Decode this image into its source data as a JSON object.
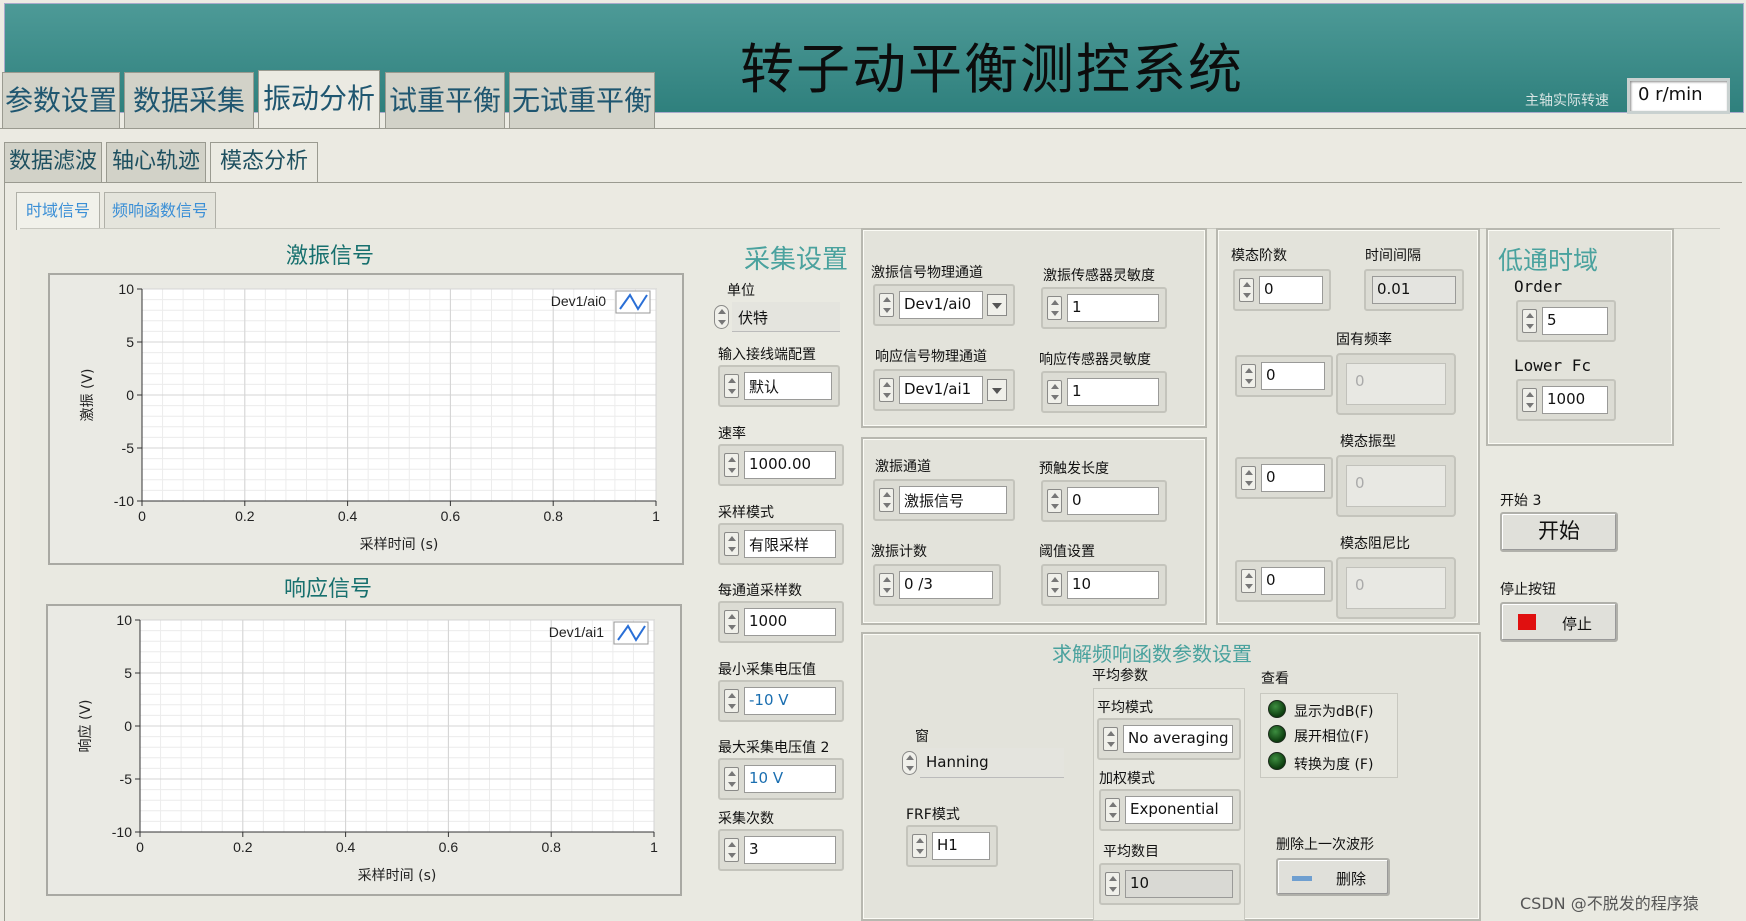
{
  "header": {
    "title": "转子动平衡测控系统",
    "speed_label": "主轴实际转速",
    "speed_value": "0 r/min"
  },
  "main_tabs": [
    "参数设置",
    "数据采集",
    "振动分析",
    "试重平衡",
    "无试重平衡"
  ],
  "sub_tabs": [
    "数据滤波",
    "轴心轨迹",
    "模态分析"
  ],
  "inner_tabs": [
    "时域信号",
    "频响函数信号"
  ],
  "charts": {
    "excitation": {
      "title": "激振信号",
      "legend": "Dev1/ai0",
      "ylabel": "激振 (V)",
      "xlabel": "采样时间 (s)"
    },
    "response": {
      "title": "响应信号",
      "legend": "Dev1/ai1",
      "ylabel": "响应 (V)",
      "xlabel": "采样时间 (s)"
    }
  },
  "chart_data": [
    {
      "type": "line",
      "title": "激振信号",
      "xlabel": "采样时间 (s)",
      "ylabel": "激振 (V)",
      "xlim": [
        0,
        1
      ],
      "ylim": [
        -10,
        10
      ],
      "x_ticks": [
        "0",
        "0.2",
        "0.4",
        "0.6",
        "0.8",
        "1"
      ],
      "y_ticks": [
        "10",
        "5",
        "0",
        "-5",
        "-10"
      ],
      "series": [
        {
          "name": "Dev1/ai0",
          "values": []
        }
      ],
      "grid": true,
      "legend_position": "top-right"
    },
    {
      "type": "line",
      "title": "响应信号",
      "xlabel": "采样时间 (s)",
      "ylabel": "响应 (V)",
      "xlim": [
        0,
        1
      ],
      "ylim": [
        -10,
        10
      ],
      "x_ticks": [
        "0",
        "0.2",
        "0.4",
        "0.6",
        "0.8",
        "1"
      ],
      "y_ticks": [
        "10",
        "5",
        "0",
        "-5",
        "-10"
      ],
      "series": [
        {
          "name": "Dev1/ai1",
          "values": []
        }
      ],
      "grid": true,
      "legend_position": "top-right"
    }
  ],
  "acq": {
    "title": "采集设置",
    "unit_label": "单位",
    "unit_value": "伏特",
    "terminal_label": "输入接线端配置",
    "terminal_value": "默认",
    "rate_label": "速率",
    "rate_value": "1000.00",
    "mode_label": "采样模式",
    "mode_value": "有限采样",
    "samples_label": "每通道采样数",
    "samples_value": "1000",
    "min_label": "最小采集电压值",
    "min_value": "-10  V",
    "max_label": "最大采集电压值 2",
    "max_value": "10  V",
    "count_label": "采集次数",
    "count_value": "3"
  },
  "channels": {
    "exc_phys_label": "激振信号物理通道",
    "exc_phys_value": "Dev1/ai0",
    "exc_sens_label": "激振传感器灵敏度",
    "exc_sens_value": "1",
    "resp_phys_label": "响应信号物理通道",
    "resp_phys_value": "Dev1/ai1",
    "resp_sens_label": "响应传感器灵敏度",
    "resp_sens_value": "1"
  },
  "trigger": {
    "exc_ch_label": "激振通道",
    "exc_ch_value": "激振信号",
    "pretrig_label": "预触发长度",
    "pretrig_value": "0",
    "exc_count_label": "激振计数",
    "exc_count_value": "0 /3",
    "threshold_label": "阈值设置",
    "threshold_value": "10"
  },
  "modal": {
    "order_label": "模态阶数",
    "order_value": "0",
    "interval_label": "时间间隔",
    "interval_value": "0.01",
    "natfreq_label": "固有频率",
    "natfreq_index": "0",
    "natfreq_value": "0",
    "shape_label": "模态振型",
    "shape_index": "0",
    "shape_value": "0",
    "damping_label": "模态阻尼比",
    "damping_index": "0",
    "damping_value": "0"
  },
  "lowpass": {
    "title": "低通时域",
    "order_label": "Order",
    "order_value": "5",
    "fc_label": "Lower Fc",
    "fc_value": "1000"
  },
  "control": {
    "start_label": "开始 3",
    "start_button": "开始",
    "stop_label": "停止按钮",
    "stop_button": "停止"
  },
  "frf": {
    "title": "求解频响函数参数设置",
    "avg_params_label": "平均参数",
    "avg_mode_label": "平均模式",
    "avg_mode_value": "No averaging",
    "weight_label": "加权模式",
    "weight_value": "Exponential",
    "avg_count_label": "平均数目",
    "avg_count_value": "10",
    "window_label": "窗",
    "window_value": "Hanning",
    "frf_mode_label": "FRF模式",
    "frf_mode_value": "H1",
    "view_label": "查看",
    "view_items": [
      "显示为dB(F)",
      "展开相位(F)",
      "转换为度 (F)"
    ],
    "delete_label": "删除上一次波形",
    "delete_button": "删除"
  },
  "watermark": "CSDN @不脱发的程序猿",
  "colors": {
    "header": "#3a8b88",
    "section_title": "#4aa29e",
    "stop_red": "#e01010"
  }
}
